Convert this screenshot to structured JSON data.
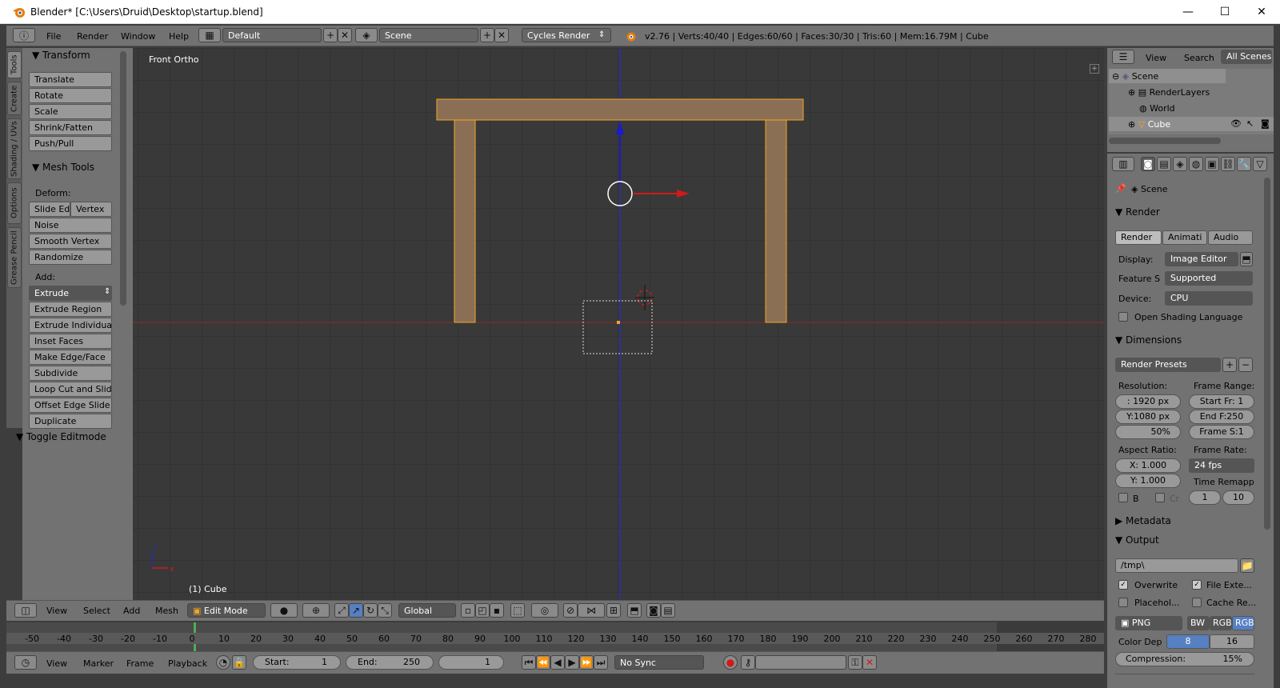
{
  "window": {
    "title": "Blender* [C:\\Users\\Druid\\Desktop\\startup.blend]",
    "minimize": "—",
    "maximize": "☐",
    "close": "✕"
  },
  "topbar": {
    "menus": [
      "File",
      "Render",
      "Window",
      "Help"
    ],
    "layout": "Default",
    "scene": "Scene",
    "engine": "Cycles Render",
    "status": "v2.76 | Verts:40/40 | Edges:60/60 | Faces:30/30 | Tris:60 | Mem:16.79M | Cube"
  },
  "tabs": [
    "Tools",
    "Create",
    "Shading / UVs",
    "Options",
    "Grease Pencil"
  ],
  "toolshelf": {
    "transform_title": "Transform",
    "transform": [
      "Translate",
      "Rotate",
      "Scale",
      "Shrink/Fatten",
      "Push/Pull"
    ],
    "meshtools_title": "Mesh Tools",
    "deform_label": "Deform:",
    "slide_edge": "Slide Ed",
    "vertex": "Vertex",
    "deform": [
      "Noise",
      "Smooth Vertex",
      "Randomize"
    ],
    "add_label": "Add:",
    "extrude": "Extrude",
    "add": [
      "Extrude Region",
      "Extrude Individual",
      "Inset Faces",
      "Make Edge/Face",
      "Subdivide",
      "Loop Cut and Slide",
      "Offset Edge Slide",
      "Duplicate"
    ],
    "toggle_title": "Toggle Editmode"
  },
  "viewport": {
    "view_label": "Front Ortho",
    "object_label": "(1) Cube",
    "axis_z": "z",
    "axis_x": "x"
  },
  "viewheader": {
    "menus": [
      "View",
      "Select",
      "Add",
      "Mesh"
    ],
    "mode": "Edit Mode",
    "orientation": "Global"
  },
  "timeline": {
    "ticks": [
      "-50",
      "-40",
      "-30",
      "-20",
      "-10",
      "0",
      "10",
      "20",
      "30",
      "40",
      "50",
      "60",
      "70",
      "80",
      "90",
      "100",
      "110",
      "120",
      "130",
      "140",
      "150",
      "160",
      "170",
      "180",
      "190",
      "200",
      "210",
      "220",
      "230",
      "240",
      "250",
      "260",
      "270",
      "280"
    ]
  },
  "tlheader": {
    "menus": [
      "View",
      "Marker",
      "Frame",
      "Playback"
    ],
    "start": "Start:",
    "start_val": "1",
    "end": "End:",
    "end_val": "250",
    "current": "1",
    "sync": "No Sync"
  },
  "outliner": {
    "menus": [
      "View",
      "Search",
      "All Scenes"
    ],
    "items": [
      "Scene",
      "RenderLayers",
      "World",
      "Cube"
    ]
  },
  "props": {
    "scene": "Scene",
    "render_title": "Render",
    "render_btns": [
      "Render",
      "Animati",
      "Audio"
    ],
    "display_label": "Display:",
    "display_val": "Image Editor",
    "feature_label": "Feature S",
    "feature_val": "Supported",
    "device_label": "Device:",
    "device_val": "CPU",
    "osl": "Open Shading Language",
    "dimensions_title": "Dimensions",
    "presets": "Render Presets",
    "resolution_label": "Resolution:",
    "res_x": ": 1920 px",
    "res_y": "Y:1080 px",
    "res_pct": "50%",
    "frame_range_label": "Frame Range:",
    "start_fr": "Start Fr: 1",
    "end_fr": "End F:250",
    "frame_step": "Frame S:1",
    "aspect_label": "Aspect Ratio:",
    "aspect_x": "X:   1.000",
    "aspect_y": "Y:   1.000",
    "frame_rate_label": "Frame Rate:",
    "fps": "24 fps",
    "time_remap": "Time Remapp",
    "b_label": "B",
    "cr_label": "Cr",
    "remap_old": "1",
    "remap_new": "10",
    "metadata_title": "Metadata",
    "output_title": "Output",
    "output_path": "/tmp\\",
    "overwrite": "Overwrite",
    "file_ext": "File Exte...",
    "placeholders": "Placehol...",
    "cache_result": "Cache Re...",
    "format": "PNG",
    "color_modes": [
      "BW",
      "RGB",
      "RGB"
    ],
    "color_depth_label": "Color Dep",
    "depth_8": "8",
    "depth_16": "16",
    "compression": "Compression:",
    "compression_val": "15%"
  }
}
